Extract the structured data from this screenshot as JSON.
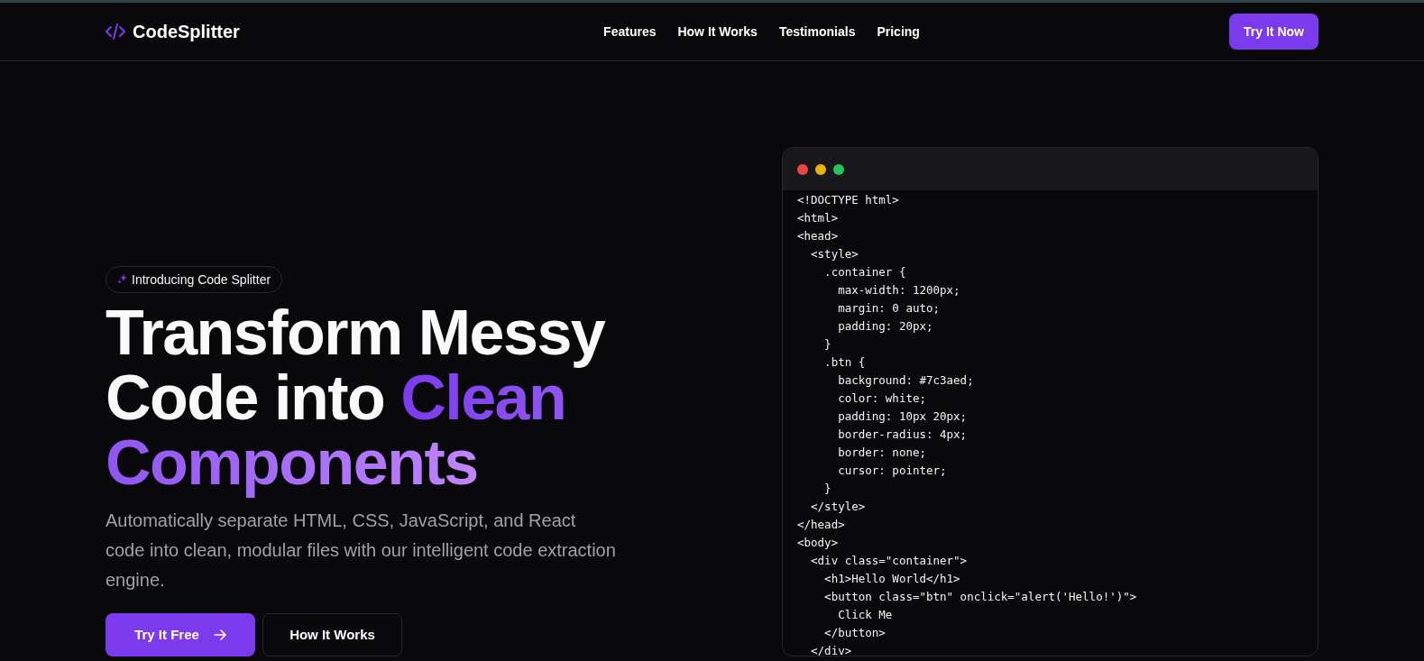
{
  "nav": {
    "logo_text": "CodeSplitter",
    "links": [
      "Features",
      "How It Works",
      "Testimonials",
      "Pricing"
    ],
    "cta": "Try It Now"
  },
  "hero": {
    "badge": "Introducing Code Splitter",
    "heading": [
      {
        "text": "Transform Messy Code into ",
        "highlight": false
      },
      {
        "text": "Clean Components",
        "highlight": true
      }
    ],
    "description": "Automatically separate HTML, CSS, JavaScript, and React code into clean, modular files with our intelligent code extraction engine.",
    "buttons": [
      {
        "label": "Try It Free",
        "kind": "primary"
      },
      {
        "label": "How It Works",
        "kind": "outline"
      }
    ]
  },
  "code_window": {
    "lines": [
      "<!DOCTYPE html>",
      "<html>",
      "<head>",
      "  <style>",
      "    .container {",
      "      max-width: 1200px;",
      "      margin: 0 auto;",
      "      padding: 20px;",
      "    }",
      "    .btn {",
      "      background: #7c3aed;",
      "      color: white;",
      "      padding: 10px 20px;",
      "      border-radius: 4px;",
      "      border: none;",
      "      cursor: pointer;",
      "    }",
      "  </style>",
      "</head>",
      "<body>",
      "  <div class=\"container\">",
      "    <h1>Hello World</h1>",
      "    <button class=\"btn\" onclick=\"alert('Hello!')\">",
      "      Click Me",
      "    </button>",
      "  </div>"
    ]
  }
}
